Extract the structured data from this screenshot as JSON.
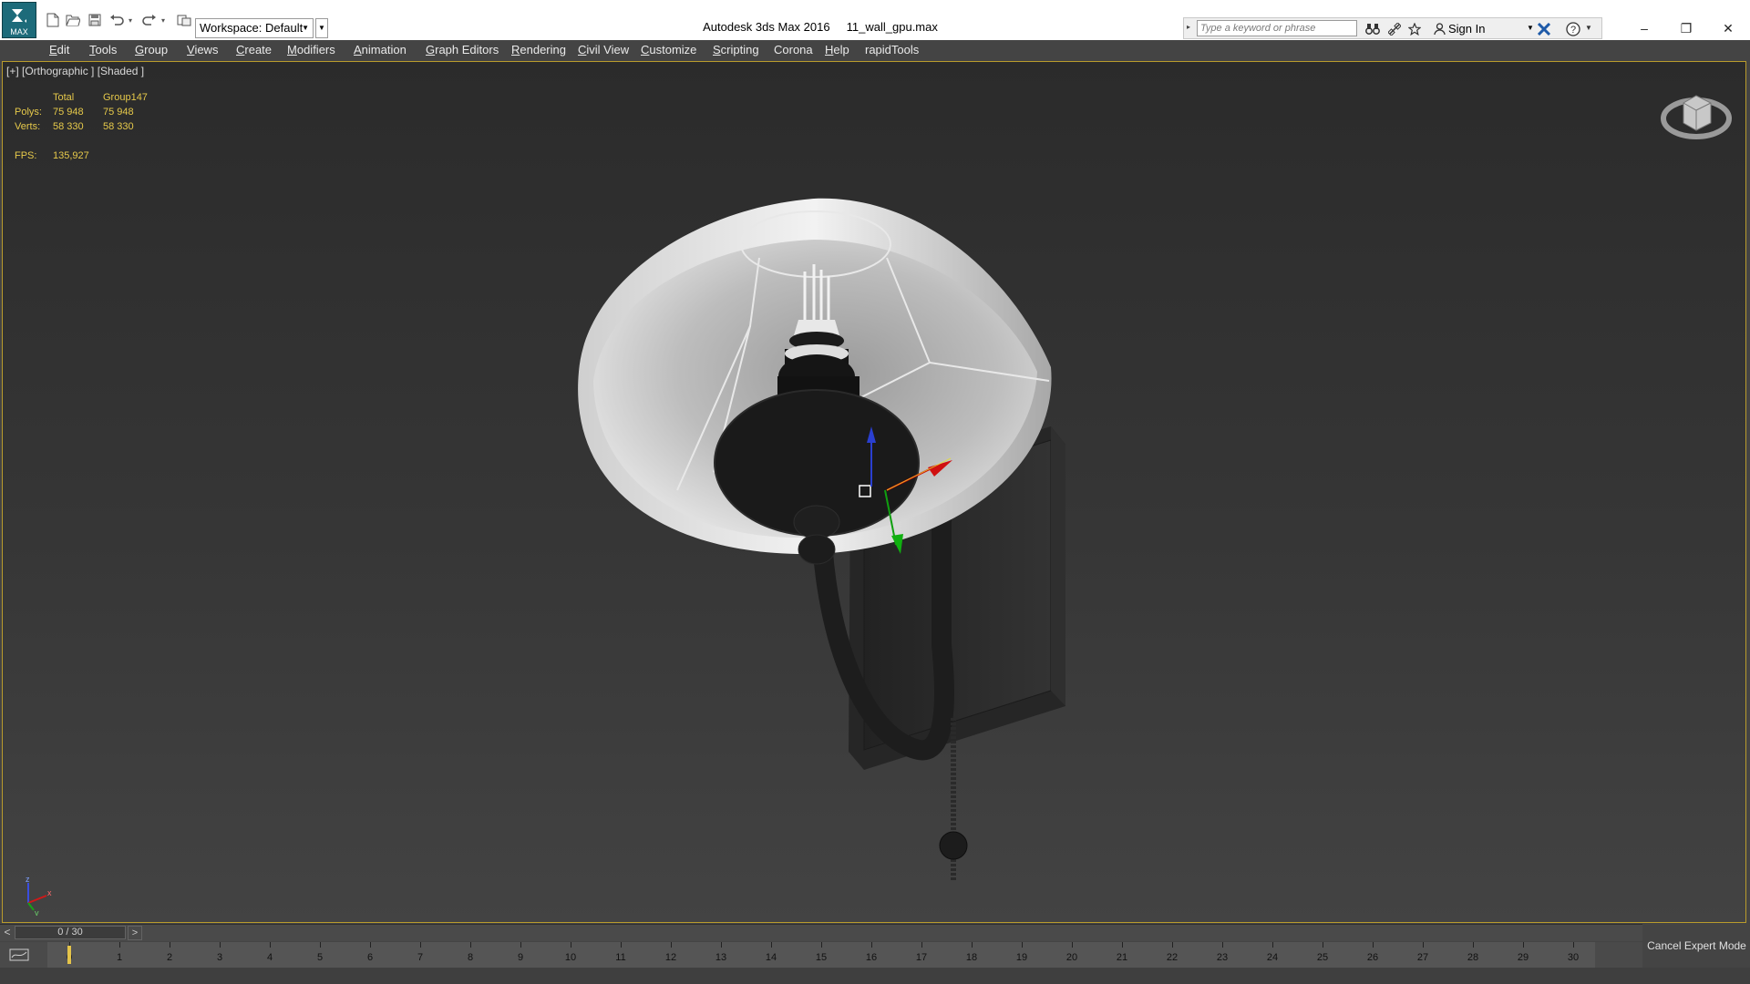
{
  "app": {
    "logo_text": "MAX",
    "title": "Autodesk 3ds Max 2016",
    "filename": "11_wall_gpu.max"
  },
  "toolbar": {
    "workspace": "Workspace: Default",
    "icons": [
      "new-file-icon",
      "open-folder-icon",
      "save-icon",
      "undo-icon",
      "redo-icon",
      "project-folder-icon"
    ]
  },
  "search": {
    "placeholder": "Type a keyword or phrase",
    "icons": [
      "binoculars-icon",
      "satellite-icon",
      "star-icon"
    ]
  },
  "account": {
    "signin": "Sign In",
    "icons": [
      "user-icon",
      "exchange-x-icon",
      "help-icon"
    ]
  },
  "window_controls": {
    "minimize": "–",
    "restore": "❐",
    "close": "✕"
  },
  "menu": [
    {
      "label": "Edit",
      "underline": "E"
    },
    {
      "label": "Tools",
      "underline": "T"
    },
    {
      "label": "Group",
      "underline": "G"
    },
    {
      "label": "Views",
      "underline": "V"
    },
    {
      "label": "Create",
      "underline": "C"
    },
    {
      "label": "Modifiers",
      "underline": "M"
    },
    {
      "label": "Animation",
      "underline": "A"
    },
    {
      "label": "Graph Editors",
      "underline": "G"
    },
    {
      "label": "Rendering",
      "underline": "R"
    },
    {
      "label": "Civil View",
      "underline": "C"
    },
    {
      "label": "Customize",
      "underline": "C"
    },
    {
      "label": "Scripting",
      "underline": "S"
    },
    {
      "label": "Corona",
      "underline": ""
    },
    {
      "label": "Help",
      "underline": "H"
    },
    {
      "label": "rapidTools",
      "underline": ""
    }
  ],
  "viewport": {
    "label": "[+] [Orthographic ] [Shaded ]",
    "stats": {
      "headers": [
        "Total",
        "Group147"
      ],
      "rows": [
        {
          "label": "Polys:",
          "total": "75 948",
          "group": "75 948"
        },
        {
          "label": "Verts:",
          "total": "58 330",
          "group": "58 330"
        }
      ],
      "fps_label": "FPS:",
      "fps_value": "135,927"
    },
    "axis_labels": {
      "x": "x",
      "y": "y",
      "z": "z"
    }
  },
  "timeline": {
    "slider_text": "0 / 30",
    "prev": "<",
    "next": ">",
    "current_frame": 0,
    "frames": [
      "0",
      "1",
      "2",
      "3",
      "4",
      "5",
      "6",
      "7",
      "8",
      "9",
      "10",
      "11",
      "12",
      "13",
      "14",
      "15",
      "16",
      "17",
      "18",
      "19",
      "20",
      "21",
      "22",
      "23",
      "24",
      "25",
      "26",
      "27",
      "28",
      "29",
      "30"
    ]
  },
  "expert_mode": {
    "label": "Cancel Expert Mode"
  },
  "colors": {
    "accent": "#b99b2c",
    "stats": "#e6c94a",
    "viewport_bg": "#303030"
  }
}
